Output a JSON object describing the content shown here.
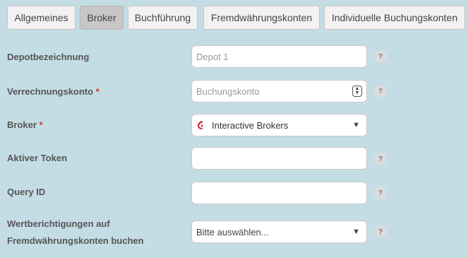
{
  "tabs": [
    {
      "label": "Allgemeines",
      "active": false
    },
    {
      "label": "Broker",
      "active": true
    },
    {
      "label": "Buchführung",
      "active": false
    },
    {
      "label": "Fremdwährungskonten",
      "active": false
    },
    {
      "label": "Individuelle Buchungskonten",
      "active": false
    }
  ],
  "form": {
    "depot": {
      "label": "Depotbezeichnung",
      "placeholder": "Depot 1"
    },
    "verrechnung": {
      "label": "Verrechnungskonto",
      "required_mark": "*",
      "placeholder": "Buchungskonto"
    },
    "broker": {
      "label": "Broker",
      "required_mark": "*",
      "value": "Interactive Brokers",
      "icon": "interactive-brokers-logo"
    },
    "token": {
      "label": "Aktiver Token",
      "value": ""
    },
    "query": {
      "label": "Query ID",
      "value": ""
    },
    "wertberichtigung": {
      "label_line1": "Wertberichtigungen auf",
      "label_line2": "Fremdwährungskonten buchen",
      "placeholder": "Bitte auswählen..."
    }
  },
  "help_glyph": "?",
  "caret_glyph": "▼",
  "colors": {
    "background": "#c4dde5",
    "required": "#dd3333",
    "broker_logo": "#c8102e"
  }
}
